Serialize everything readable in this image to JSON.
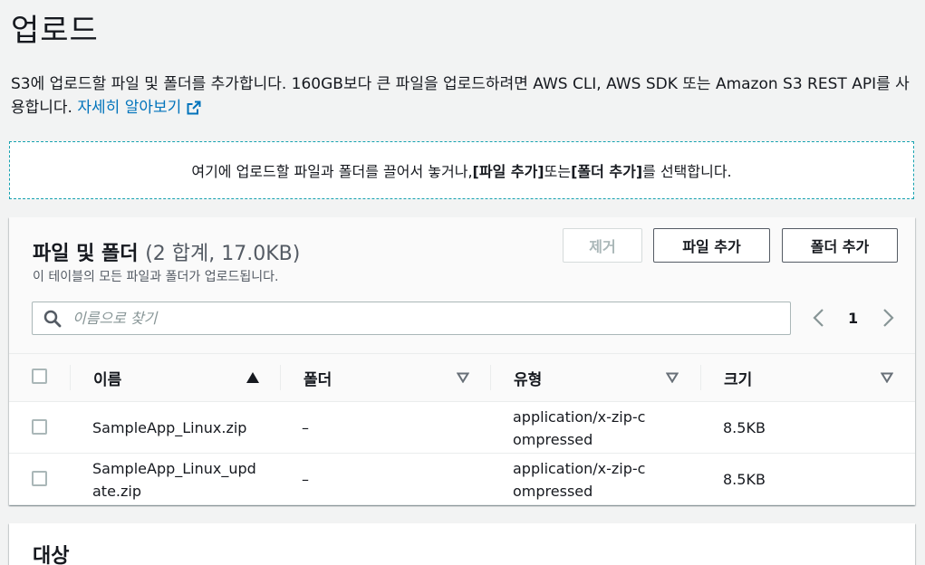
{
  "page": {
    "title": "업로드",
    "description": "S3에 업로드할 파일 및 폴더를 추가합니다. 160GB보다 큰 파일을 업로드하려면 AWS CLI, AWS SDK 또는 Amazon S3 REST API를 사용합니다.",
    "learn_more": "자세히 알아보기"
  },
  "dropzone": {
    "text_before": "여기에 업로드할 파일과 폴더를 끌어서 놓거나, ",
    "add_files_ref": "[파일 추가]",
    "text_mid": " 또는 ",
    "add_folder_ref": "[폴더 추가]",
    "text_after": "를 선택합니다."
  },
  "files_panel": {
    "title": "파일 및 폴더",
    "count": "(2 합계, 17.0KB)",
    "subtitle": "이 테이블의 모든 파일과 폴더가 업로드됩니다.",
    "buttons": {
      "remove": "제거",
      "add_files": "파일 추가",
      "add_folder": "폴더 추가"
    },
    "search_placeholder": "이름으로 찾기",
    "page_number": "1",
    "columns": [
      "이름",
      "폴더",
      "유형",
      "크기"
    ],
    "rows": [
      {
        "name": "SampleApp_Linux.zip",
        "folder": "–",
        "type": "application/x-zip-compressed",
        "size": "8.5KB"
      },
      {
        "name": "SampleApp_Linux_update.zip",
        "folder": "–",
        "type": "application/x-zip-compressed",
        "size": "8.5KB"
      }
    ]
  },
  "destination_panel": {
    "title": "대상"
  },
  "colors": {
    "link": "#0073bb",
    "dropzone_border": "#16a2b0",
    "page_bg": "#f2f3f3"
  },
  "icons": {
    "external_link": "external-link-icon",
    "search": "search-icon",
    "sort_ascending": "sort-ascending-icon",
    "sort": "sort-icon",
    "pager_prev": "chevron-left-icon",
    "pager_next": "chevron-right-icon"
  }
}
